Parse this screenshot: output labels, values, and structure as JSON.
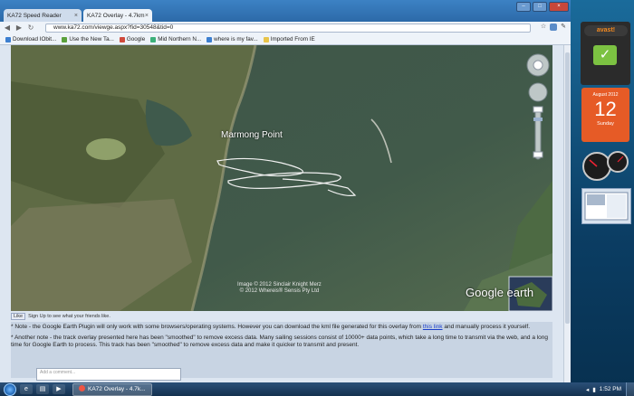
{
  "browser": {
    "tabs": [
      {
        "title": "KA72 Speed Reader",
        "active": false
      },
      {
        "title": "KA72 Overlay - 4.7km",
        "active": true
      }
    ],
    "url": "www.ka72.com/viewge.aspx?fid=30548&tid=0",
    "bookmarks": [
      {
        "label": "Download IObit...",
        "color": "#3c7fd0"
      },
      {
        "label": "Use the New Ta...",
        "color": "#5aa03c"
      },
      {
        "label": "Google",
        "color": "#d04a3c"
      },
      {
        "label": "Mid Northern N...",
        "color": "#3cb07a"
      },
      {
        "label": "where is my fav...",
        "color": "#3c7fd0"
      },
      {
        "label": "Imported From IE",
        "color": "#e8c44a"
      }
    ]
  },
  "map": {
    "place_label": "Marmong Point",
    "credits": [
      "Image © 2012 Sinclair Knight Merz",
      "© 2012 Whereis® Sensis Pty Ltd"
    ],
    "brand": "Google earth"
  },
  "social": {
    "like_label": "Like",
    "signup_text": "Sign Up to see what your friends like."
  },
  "notes": {
    "note1_before": "* Note - the Google Earth Plugin will only work with some browsers/operating systems. However you can download the kml file generated for this overlay from ",
    "note1_link": "this link",
    "note1_after": " and manually process it yourself.",
    "note2": "* Another note - the track overlay presented here has been \"smoothed\" to remove excess data. Many sailing sessions consist of 10000+ data points, which take a long time to transmit via the web, and a long time for Google Earth to process. This track has been \"smoothed\" to remove excess data and make it quicker to transmit and present."
  },
  "comment": {
    "placeholder": "Add a comment..."
  },
  "taskbar": {
    "task_label": "KA72 Overlay - 4.7k...",
    "time": "1:52 PM"
  },
  "gadgets": {
    "avast_label": "avast!",
    "calendar": {
      "month": "August 2012",
      "day": "12",
      "weekday": "Sunday"
    }
  }
}
